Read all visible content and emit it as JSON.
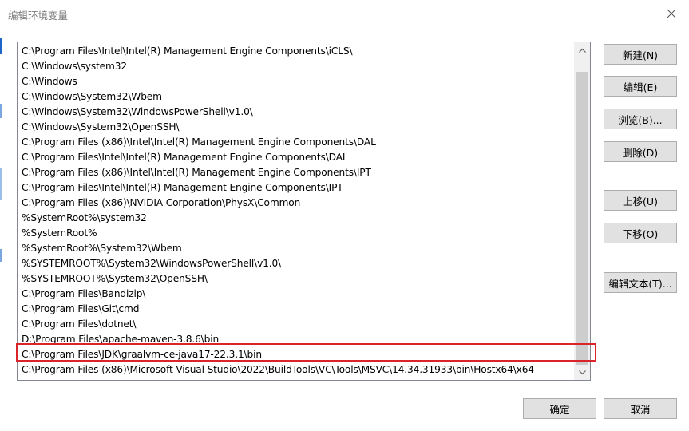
{
  "window": {
    "title": "编辑环境变量"
  },
  "path_list": {
    "items": [
      "C:\\Program Files\\Intel\\Intel(R) Management Engine Components\\iCLS\\",
      "C:\\Windows\\system32",
      "C:\\Windows",
      "C:\\Windows\\System32\\Wbem",
      "C:\\Windows\\System32\\WindowsPowerShell\\v1.0\\",
      "C:\\Windows\\System32\\OpenSSH\\",
      "C:\\Program Files (x86)\\Intel\\Intel(R) Management Engine Components\\DAL",
      "C:\\Program Files\\Intel\\Intel(R) Management Engine Components\\DAL",
      "C:\\Program Files (x86)\\Intel\\Intel(R) Management Engine Components\\IPT",
      "C:\\Program Files\\Intel\\Intel(R) Management Engine Components\\IPT",
      "C:\\Program Files (x86)\\NVIDIA Corporation\\PhysX\\Common",
      "%SystemRoot%\\system32",
      "%SystemRoot%",
      "%SystemRoot%\\System32\\Wbem",
      "%SYSTEMROOT%\\System32\\WindowsPowerShell\\v1.0\\",
      "%SYSTEMROOT%\\System32\\OpenSSH\\",
      "C:\\Program Files\\Bandizip\\",
      "C:\\Program Files\\Git\\cmd",
      "C:\\Program Files\\dotnet\\",
      "D:\\Program Files\\apache-maven-3.8.6\\bin",
      "C:\\Program Files\\JDK\\graalvm-ce-java17-22.3.1\\bin",
      "C:\\Program Files (x86)\\Microsoft Visual Studio\\2022\\BuildTools\\VC\\Tools\\MSVC\\14.34.31933\\bin\\Hostx64\\x64"
    ]
  },
  "buttons": {
    "new": "新建(N)",
    "edit": "编辑(E)",
    "browse": "浏览(B)...",
    "delete": "删除(D)",
    "move_up": "上移(U)",
    "move_down": "下移(O)",
    "edit_text": "编辑文本(T)...",
    "ok": "确定",
    "cancel": "取消"
  },
  "icons": {
    "close": "close-icon",
    "scroll_up": "chevron-up-icon",
    "scroll_down": "chevron-down-icon"
  },
  "colors": {
    "highlight": "#d9252a",
    "button_bg": "#e1e1e1",
    "scrollbar_thumb": "#cdcdcd"
  }
}
